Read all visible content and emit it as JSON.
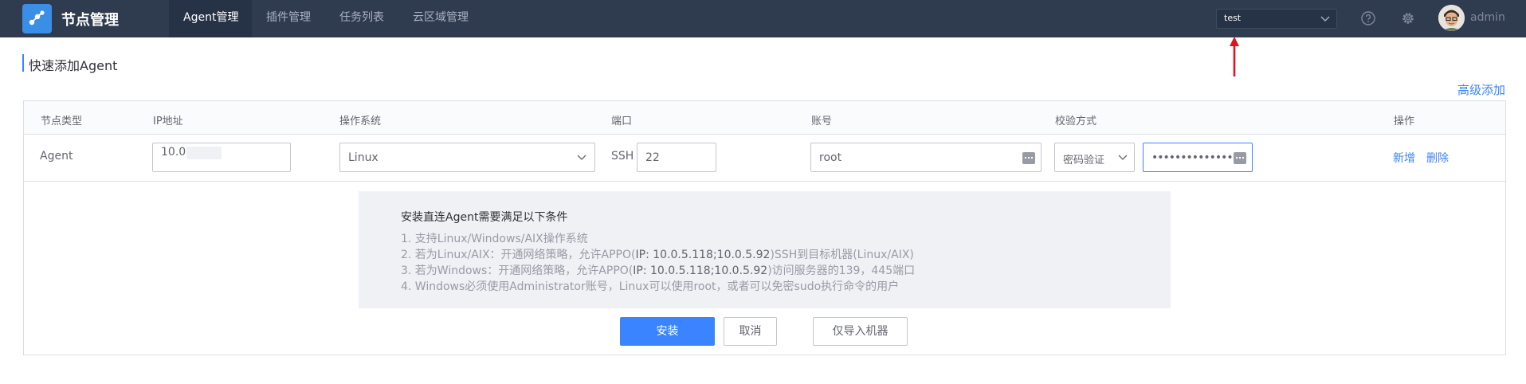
{
  "header": {
    "app_title": "节点管理",
    "nav": [
      "Agent管理",
      "插件管理",
      "任务列表",
      "云区域管理"
    ],
    "active_nav": "Agent管理",
    "tenant_select": "test",
    "user_name": "admin",
    "icons": [
      "app-logo-icon",
      "help-icon",
      "gear-icon",
      "avatar"
    ]
  },
  "page": {
    "title": "快速添加Agent",
    "advanced_link": "高级添加"
  },
  "table": {
    "columns": [
      "节点类型",
      "IP地址",
      "操作系统",
      "端口",
      "账号",
      "校验方式",
      "操作"
    ],
    "row": {
      "node_type": "Agent",
      "ip": "10.0",
      "os": "Linux",
      "port_prefix": "SSH",
      "port": "22",
      "account": "root",
      "auth_method": "密码验证",
      "password": "••••••••••••••",
      "actions": [
        "新增",
        "删除"
      ]
    }
  },
  "info": {
    "title": "安装直连Agent需要满足以下条件",
    "line1": "1. 支持Linux/Windows/AIX操作系统",
    "line2_a": "2. 若为Linux/AIX：开通网络策略，允许APPO(",
    "line2_hl": "IP: 10.0.5.118;10.0.5.92",
    "line2_b": ")SSH到目标机器(Linux/AIX)",
    "line3_a": "3. 若为Windows：开通网络策略，允许APPO(",
    "line3_hl": "IP: 10.0.5.118;10.0.5.92",
    "line3_b": ")访问服务器的139，445端口",
    "line4": "4. Windows必须使用Administrator账号，Linux可以使用root，或者可以免密sudo执行命令的用户"
  },
  "buttons": {
    "install": "安装",
    "cancel": "取消",
    "import_only": "仅导入机器"
  },
  "colors": {
    "header_bg": "#2f3b4f",
    "primary": "#3a84ff",
    "annotation_arrow": "#e0141e"
  }
}
